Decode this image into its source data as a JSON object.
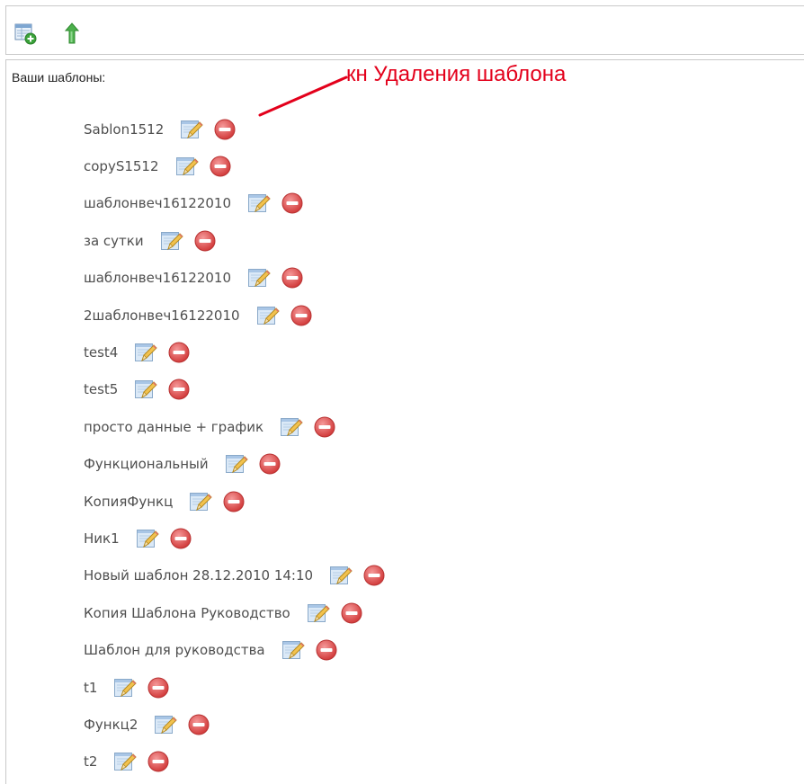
{
  "toolbar": {
    "add_icon": "add-template-icon",
    "up_icon": "upload-arrow-icon"
  },
  "panel": {
    "heading": "Ваши шаблоны:",
    "annotation": "кн Удаления шаблона"
  },
  "templates": [
    {
      "name": "Sablon1512"
    },
    {
      "name": "copyS1512"
    },
    {
      "name": "шаблонвеч16122010"
    },
    {
      "name": "за сутки"
    },
    {
      "name": "шаблонвеч16122010"
    },
    {
      "name": "2шаблонвеч16122010"
    },
    {
      "name": "test4"
    },
    {
      "name": "test5"
    },
    {
      "name": "просто данные + график"
    },
    {
      "name": "Функциональный"
    },
    {
      "name": "КопияФункц"
    },
    {
      "name": "Ник1"
    },
    {
      "name": "Новый шаблон 28.12.2010 14:10"
    },
    {
      "name": "Копия Шаблона Руководство"
    },
    {
      "name": "Шаблон для руководства"
    },
    {
      "name": "t1"
    },
    {
      "name": "Функц2"
    },
    {
      "name": "t2"
    }
  ],
  "colors": {
    "annotation": "#e3001b",
    "delete_button": "#e05050",
    "edit_pencil": "#e8b84a",
    "up_arrow": "#3ca83c",
    "border": "#c9c9c9"
  }
}
